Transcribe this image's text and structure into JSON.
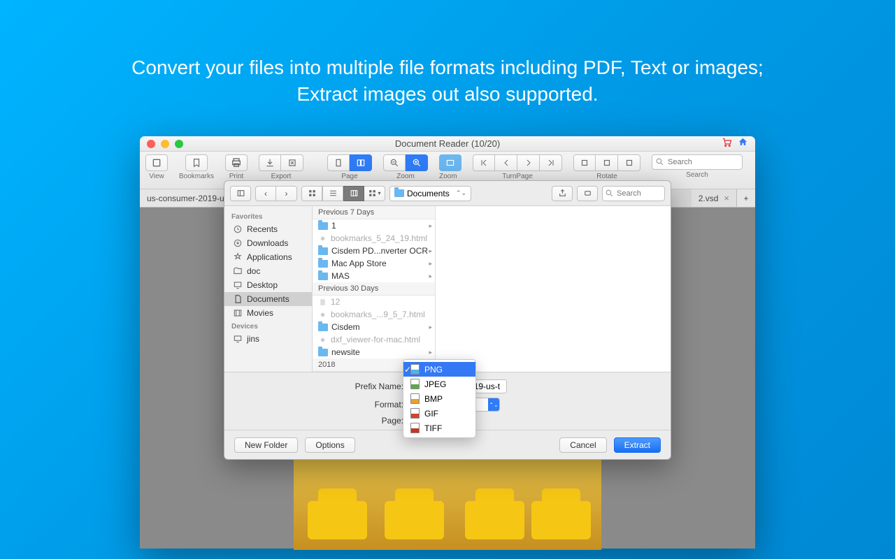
{
  "marketing": {
    "line1": "Convert your files into multiple file formats including PDF, Text or images;",
    "line2": "Extract images out also supported."
  },
  "window": {
    "title": "Document Reader (10/20)"
  },
  "toolbar": {
    "view": "View",
    "bookmarks": "Bookmarks",
    "print": "Print",
    "export": "Export",
    "page": "Page",
    "zoom": "Zoom",
    "zoom_to_fit": "Zoom to Fit",
    "turnpage": "TurnPage",
    "rotate": "Rotate",
    "search_label": "Search",
    "search_placeholder": "Search"
  },
  "tabs": {
    "left": "us-consumer-2019-us",
    "right": "2.vsd"
  },
  "sheet": {
    "path_label": "Documents",
    "search_placeholder": "Search",
    "favorites_header": "Favorites",
    "devices_header": "Devices",
    "sidebar": {
      "recents": "Recents",
      "downloads": "Downloads",
      "applications": "Applications",
      "doc": "doc",
      "desktop": "Desktop",
      "documents": "Documents",
      "movies": "Movies",
      "jins": "jins"
    },
    "col_headers": {
      "prev7": "Previous 7 Days",
      "prev30": "Previous 30 Days",
      "y2018": "2018"
    },
    "files": {
      "f1": "1",
      "f2": "bookmarks_5_24_19.html",
      "f3": "Cisdem PD...nverter OCR",
      "f4": "Mac App Store",
      "f5": "MAS",
      "f6": "12",
      "f7": "bookmarks_...9_5_7.html",
      "f8": "Cisdem",
      "f9": "dxf_viewer-for-mac.html",
      "f10": "newsite"
    },
    "form": {
      "prefix_label": "Prefix Name:",
      "prefix_value": "us-consumer-2019-us-t",
      "format_label": "Format:",
      "format_value": "PNG",
      "page_label": "Page:"
    },
    "buttons": {
      "new_folder": "New Folder",
      "options": "Options",
      "cancel": "Cancel",
      "extract": "Extract"
    }
  },
  "dropdown": {
    "png": "PNG",
    "jpeg": "JPEG",
    "bmp": "BMP",
    "gif": "GIF",
    "tiff": "TIFF"
  }
}
